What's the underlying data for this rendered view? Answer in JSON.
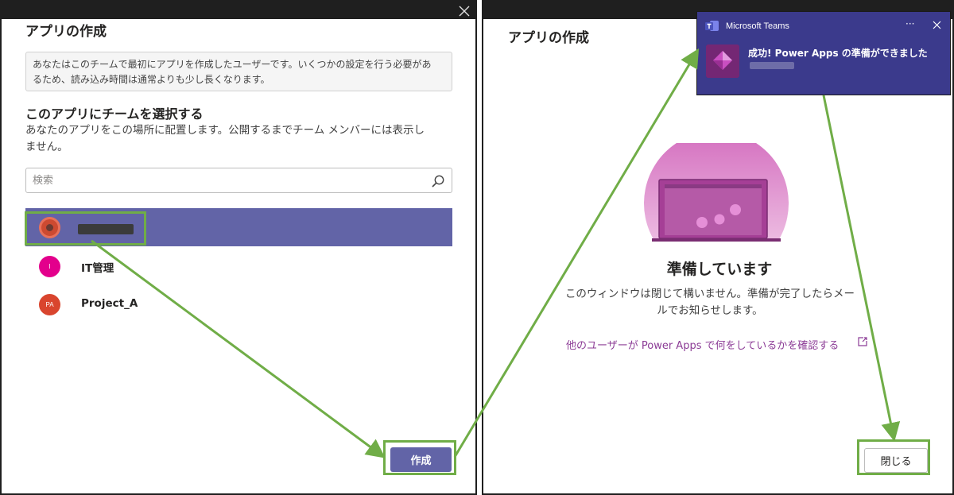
{
  "left_dialog": {
    "title": "アプリの作成",
    "info_line1": "あなたはこのチームで最初にアプリを作成したユーザーです。いくつかの設定を行う必要があ",
    "info_line2": "るため、読み込み時間は通常よりも少し長くなります。",
    "section_title": "このアプリにチームを選択する",
    "section_desc_line1": "あなたのアプリをこの場所に配置します。公開するまでチーム メンバーには表示し",
    "section_desc_line2": "ません。",
    "search_placeholder": "検索",
    "teams": [
      {
        "name": "",
        "initials": "",
        "color": "#cc4a31",
        "selected": true
      },
      {
        "name": "IT管理",
        "initials": "I",
        "color": "#e3008c",
        "selected": false
      },
      {
        "name": "Project_A",
        "initials": "PA",
        "color": "#d9452e",
        "selected": false
      }
    ],
    "create_button": "作成"
  },
  "right_dialog": {
    "title": "アプリの作成",
    "preparing_title": "準備しています",
    "preparing_desc_line1": "このウィンドウは閉じて構いません。準備が完了したらメー",
    "preparing_desc_line2": "ルでお知らせします。",
    "link_text": "他のユーザーが Power Apps で何をしているかを確認する",
    "close_button": "閉じる"
  },
  "toast": {
    "app_name": "Microsoft Teams",
    "more": "···",
    "message": "成功! Power Apps の準備ができました"
  },
  "colors": {
    "teams_purple": "#6264a7",
    "highlight_green": "#70ad47",
    "power_apps_purple": "#742774",
    "link_purple": "#8c3c96"
  }
}
